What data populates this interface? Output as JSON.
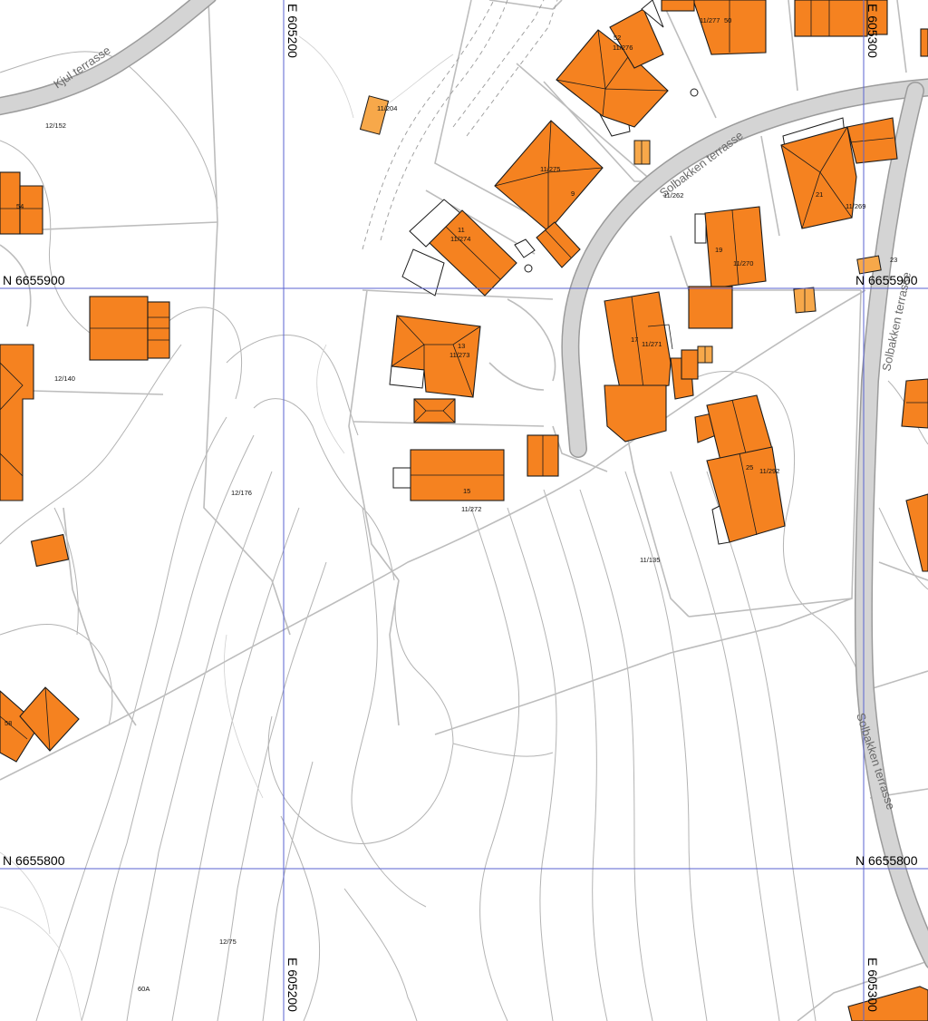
{
  "grid": {
    "easting_labels": [
      "E 605200",
      "E 605300"
    ],
    "northing_labels": [
      "N 6655900",
      "N 6655800"
    ]
  },
  "roads": {
    "kjul": "Kjul terrasse",
    "solbakken_upper": "Solbakken terrasse",
    "solbakken_east": "Solbakken terrasse",
    "solbakken_lower": "Solbakken terrasse"
  },
  "parcels": {
    "p12_152": "12/152",
    "p12_140": "12/140",
    "p12_176": "12/176",
    "p12_75": "12/75",
    "p60a": "60A",
    "p11_135": "11/135",
    "p11_204": "11/204",
    "p11_262": "11/262",
    "p11_272": "11/272",
    "p11_275": "11/275",
    "p11_274": "11/274",
    "p11_273": "11/273",
    "p11_271": "11/271",
    "p11_270": "11/270",
    "p11_269": "11/269",
    "p11_276": "11/276",
    "p11_277": "11/277",
    "p11_292": "11/292"
  },
  "house_numbers": {
    "h54": "54",
    "h58": "58",
    "h9": "9",
    "h11": "11",
    "h13": "13",
    "h15": "15",
    "h17": "17",
    "h19": "19",
    "h21": "21",
    "h23": "23",
    "h25": "25",
    "h50": "50",
    "h52": "52"
  },
  "colors": {
    "building": "#f58220",
    "shed": "#f7a84a",
    "grid_line": "#5a63d0",
    "road": "#d4d4d4"
  }
}
